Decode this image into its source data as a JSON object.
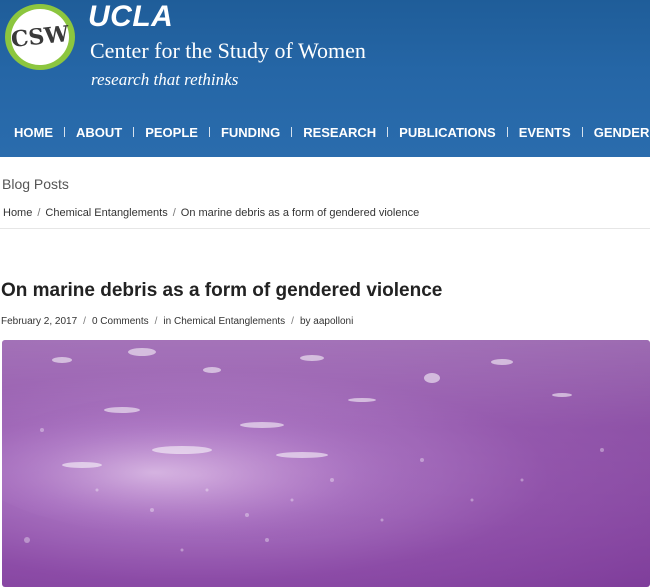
{
  "site": {
    "logo_text": "CSW",
    "ucla": "UCLA",
    "title": "Center for the Study of Women",
    "tagline": "research that rethinks",
    "colors": {
      "header": "#2566a6",
      "logo_ring": "#8cc63f",
      "hero": "#8b4aa6"
    }
  },
  "nav": {
    "items": [
      {
        "label": "HOME"
      },
      {
        "label": "ABOUT"
      },
      {
        "label": "PEOPLE"
      },
      {
        "label": "FUNDING"
      },
      {
        "label": "RESEARCH"
      },
      {
        "label": "PUBLICATIONS"
      },
      {
        "label": "EVENTS"
      },
      {
        "label": "GENDER E"
      }
    ]
  },
  "page": {
    "section": "Blog Posts",
    "breadcrumb": [
      "Home",
      "Chemical Entanglements",
      "On marine debris as a form of gendered violence"
    ]
  },
  "post": {
    "title": "On marine debris as a form of gendered violence",
    "date": "February 2, 2017",
    "comments": "0 Comments",
    "category_prefix": "in",
    "category": "Chemical Entanglements",
    "author_prefix": "by",
    "author": "aapolloni"
  }
}
